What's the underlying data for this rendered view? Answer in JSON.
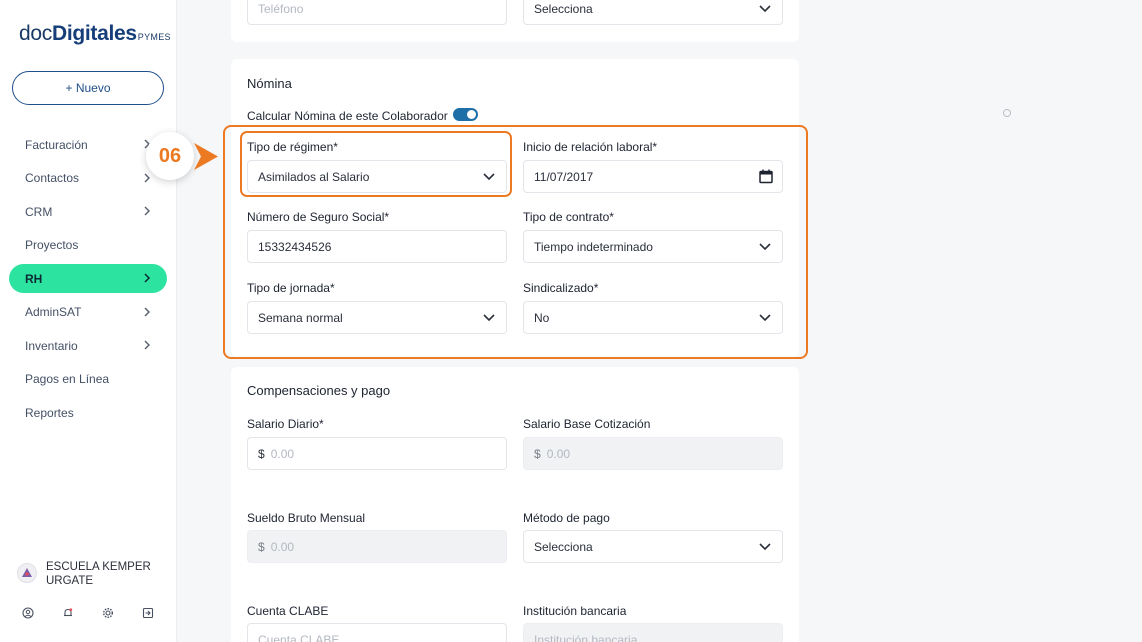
{
  "brand": {
    "doc": "doc",
    "digitales": "Digitales",
    "pymes": "PYMES"
  },
  "sidebar": {
    "new_button": "+ Nuevo",
    "items": [
      {
        "label": "Facturación",
        "chevron": true,
        "active": false
      },
      {
        "label": "Contactos",
        "chevron": true,
        "active": false
      },
      {
        "label": "CRM",
        "chevron": true,
        "active": false
      },
      {
        "label": "Proyectos",
        "chevron": false,
        "active": false
      },
      {
        "label": "RH",
        "chevron": true,
        "active": true
      },
      {
        "label": "AdminSAT",
        "chevron": true,
        "active": false
      },
      {
        "label": "Inventario",
        "chevron": true,
        "active": false
      },
      {
        "label": "Pagos en Línea",
        "chevron": false,
        "active": false
      },
      {
        "label": "Reportes",
        "chevron": false,
        "active": false
      }
    ],
    "user_name": "ESCUELA KEMPER URGATE",
    "bottom_icons": [
      "user-icon",
      "bell-icon",
      "gear-icon",
      "logout-icon"
    ]
  },
  "top": {
    "telefono_placeholder": "Teléfono",
    "select_value": "Selecciona"
  },
  "nomina": {
    "title": "Nómina",
    "toggle_label": "Calcular Nómina de este Colaborador",
    "toggle_on": true,
    "tipo_regimen_label": "Tipo de régimen*",
    "tipo_regimen_value": "Asimilados al Salario",
    "inicio_label": "Inicio de relación laboral*",
    "inicio_value": "11/07/2017",
    "nss_label": "Número de Seguro Social*",
    "nss_value": "15332434526",
    "contrato_label": "Tipo de contrato*",
    "contrato_value": "Tiempo indeterminado",
    "jornada_label": "Tipo de jornada*",
    "jornada_value": "Semana normal",
    "sindicalizado_label": "Sindicalizado*",
    "sindicalizado_value": "No"
  },
  "compensaciones": {
    "title": "Compensaciones y pago",
    "salario_diario_label": "Salario Diario*",
    "salario_base_label": "Salario Base Cotización",
    "sueldo_bruto_label": "Sueldo Bruto Mensual",
    "metodo_pago_label": "Método de pago",
    "metodo_pago_value": "Selecciona",
    "currency": "$",
    "amount_placeholder": "0.00",
    "cuenta_label": "Cuenta CLABE",
    "cuenta_placeholder": "Cuenta CLABE",
    "institucion_label": "Institución bancaria",
    "institucion_placeholder": "Institución bancaria"
  },
  "annotation": {
    "step": "06",
    "accent_color": "#ec7a23"
  }
}
